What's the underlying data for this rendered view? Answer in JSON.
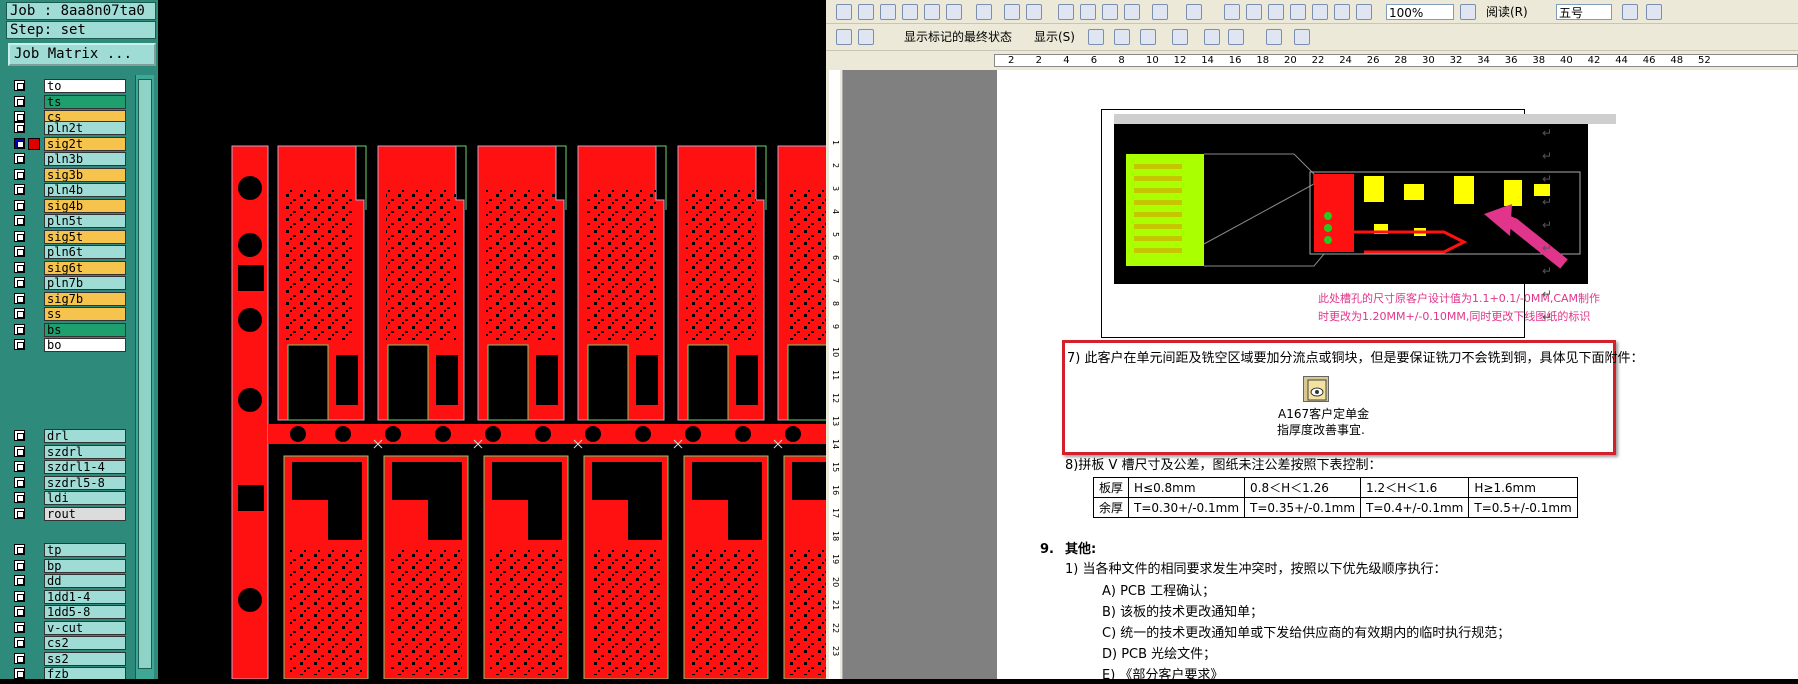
{
  "cam": {
    "job": "Job : 8aa8n07ta0",
    "step": "Step: set",
    "job_matrix_button": "Job Matrix ...",
    "layers": [
      {
        "name": "to",
        "color": "#ffffff"
      },
      {
        "name": "ts",
        "color": "#1f9e6e"
      },
      {
        "name": "cs",
        "color": "#f6c44c"
      },
      {
        "name": "pln2t",
        "color": "#9fdcd6"
      },
      {
        "name": "sig2t",
        "color": "#f6c44c",
        "active": true
      },
      {
        "name": "pln3b",
        "color": "#9fdcd6"
      },
      {
        "name": "sig3b",
        "color": "#f6c44c"
      },
      {
        "name": "pln4b",
        "color": "#9fdcd6"
      },
      {
        "name": "sig4b",
        "color": "#f6c44c"
      },
      {
        "name": "pln5t",
        "color": "#9fdcd6"
      },
      {
        "name": "sig5t",
        "color": "#f6c44c"
      },
      {
        "name": "pln6t",
        "color": "#9fdcd6"
      },
      {
        "name": "sig6t",
        "color": "#f6c44c"
      },
      {
        "name": "pln7b",
        "color": "#9fdcd6"
      },
      {
        "name": "sig7b",
        "color": "#f6c44c"
      },
      {
        "name": "ss",
        "color": "#f6c44c"
      },
      {
        "name": "bs",
        "color": "#1f9e6e"
      },
      {
        "name": "bo",
        "color": "#ffffff"
      },
      {
        "name": "drl",
        "color": "#9fdcd6"
      },
      {
        "name": "szdrl",
        "color": "#9fdcd6"
      },
      {
        "name": "szdrl1-4",
        "color": "#9fdcd6"
      },
      {
        "name": "szdrl5-8",
        "color": "#9fdcd6"
      },
      {
        "name": "ldi",
        "color": "#9fdcd6"
      },
      {
        "name": "rout",
        "color": "#dcdcdc"
      },
      {
        "name": "tp",
        "color": "#9fdcd6"
      },
      {
        "name": "bp",
        "color": "#9fdcd6"
      },
      {
        "name": "dd",
        "color": "#9fdcd6"
      },
      {
        "name": "1dd1-4",
        "color": "#9fdcd6"
      },
      {
        "name": "1dd5-8",
        "color": "#9fdcd6"
      },
      {
        "name": "v-cut",
        "color": "#9fdcd6"
      },
      {
        "name": "cs2",
        "color": "#9fdcd6"
      },
      {
        "name": "ss2",
        "color": "#9fdcd6"
      },
      {
        "name": "fzb",
        "color": "#9fdcd6"
      }
    ]
  },
  "word": {
    "toolbar": {
      "zoom": "100%",
      "read_button": "阅读(R)",
      "markup_state": "显示标记的最终状态",
      "show_menu": "显示(S)",
      "font_size": "五号"
    },
    "ruler_numbers": [
      "2",
      "2",
      "4",
      "6",
      "8",
      "10",
      "12",
      "14",
      "16",
      "18",
      "20",
      "22",
      "24",
      "26",
      "28",
      "30",
      "32",
      "34",
      "36",
      "38",
      "40",
      "42",
      "44",
      "46",
      "48",
      "52"
    ],
    "vruler_numbers": [
      "1",
      "2",
      "3",
      "4",
      "5",
      "6",
      "7",
      "8",
      "9",
      "10",
      "11",
      "12",
      "13",
      "14",
      "15",
      "16",
      "17",
      "18",
      "19",
      "20",
      "21",
      "22",
      "23"
    ],
    "image_note_line1": "此处槽孔的尺寸原客户设计值为1.1+0.1/-0MM,CAM制作",
    "image_note_line2": "时更改为1.20MM+/-0.10MM,同时更改下线图纸的标识",
    "item7": "7) 此客户在单元间距及铣空区域要加分流点或铜块，但是要保证铣刀不会铣到铜，具体见下面附件：",
    "attachment_line1": "A167客户定单金",
    "attachment_line2": "指厚度改善事宜.",
    "item8": "8)拼板 V 槽尺寸及公差，图纸未注公差按照下表控制：",
    "table": [
      [
        "板厚",
        "H≤0.8mm",
        "0.8＜H＜1.26",
        "1.2＜H＜1.6",
        "H≥1.6mm"
      ],
      [
        "余厚",
        "T=0.30+/-0.1mm",
        "T=0.35+/-0.1mm",
        "T=0.4+/-0.1mm",
        "T=0.5+/-0.1mm"
      ]
    ],
    "section9_number": "9.",
    "section9_title": "其他:",
    "item1": "1) 当各种文件的相同要求发生冲突时，按照以下优先级顺序执行：",
    "subitems": [
      "A) PCB 工程确认；",
      "B) 该板的技术更改通知单；",
      "C) 统一的技术更改通知单或下发给供应商的有效期内的临时执行规范；",
      "D) PCB 光绘文件；",
      "E) 《部分客户要求》"
    ]
  }
}
